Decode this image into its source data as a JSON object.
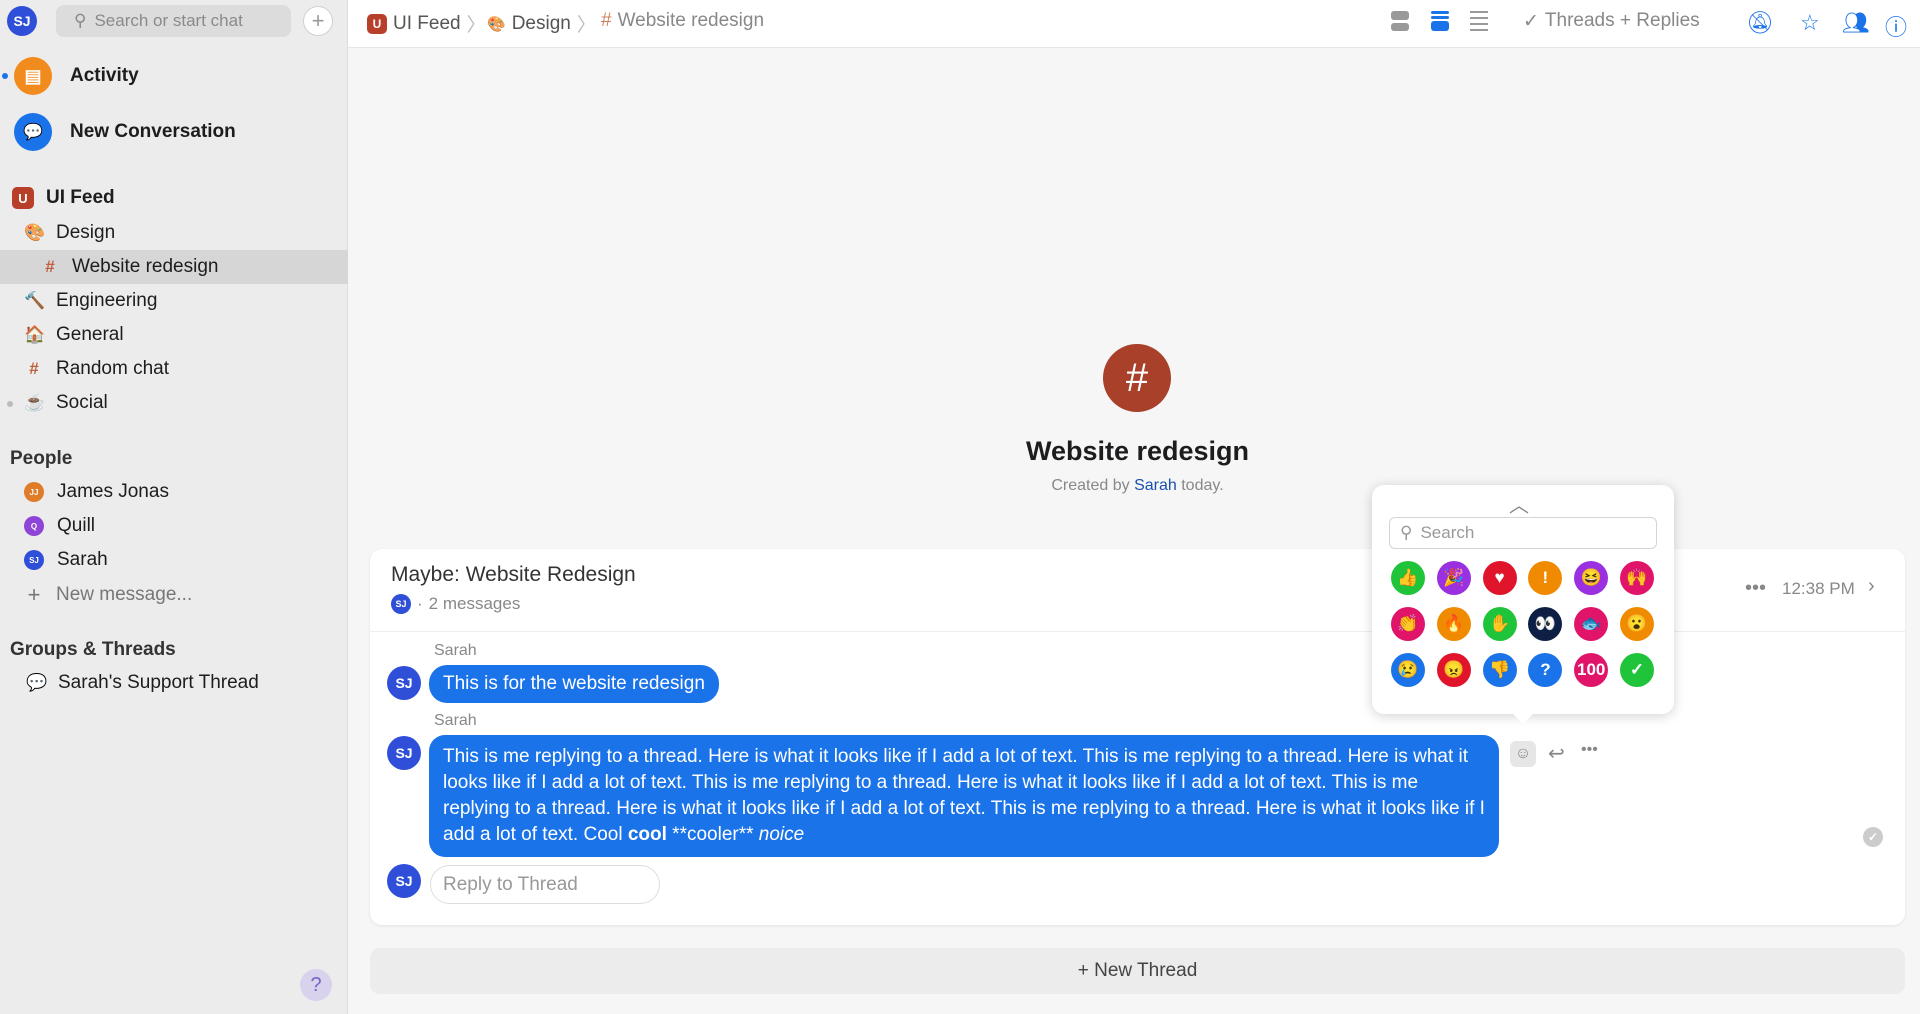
{
  "sidebar": {
    "user_initials": "SJ",
    "search_placeholder": "Search or start chat",
    "activity": "Activity",
    "new_conversation": "New Conversation",
    "workspace": "UI Feed",
    "channels": [
      {
        "label": "Design",
        "icon": "palette-icon",
        "glyph": "🎨",
        "indent": 1
      },
      {
        "label": "Website redesign",
        "icon": "hash-icon",
        "glyph": "#",
        "indent": 2,
        "selected": true
      },
      {
        "label": "Engineering",
        "icon": "hammer-icon",
        "glyph": "🔨",
        "indent": 1
      },
      {
        "label": "General",
        "icon": "home-icon",
        "glyph": "🏠",
        "indent": 1
      },
      {
        "label": "Random chat",
        "icon": "hash-icon",
        "glyph": "#",
        "indent": 1
      },
      {
        "label": "Social",
        "icon": "coffee-icon",
        "glyph": "☕",
        "indent": 1
      }
    ],
    "people_heading": "People",
    "people": [
      {
        "label": "James Jonas",
        "initials": "JJ",
        "color": "#e07b2a"
      },
      {
        "label": "Quill",
        "initials": "Q",
        "color": "#8e44d6"
      },
      {
        "label": "Sarah",
        "initials": "SJ",
        "color": "#2f4fd8"
      }
    ],
    "new_message": "New message...",
    "groups_heading": "Groups & Threads",
    "groups": [
      "Sarah's Support Thread"
    ],
    "help": "?"
  },
  "topbar": {
    "breadcrumb": [
      "UI Feed",
      "Design",
      "Website redesign"
    ],
    "filter_label": "Threads + Replies",
    "accent": "#1a73e8"
  },
  "channel": {
    "glyph": "#",
    "title": "Website redesign",
    "created_prefix": "Created by",
    "created_by": "Sarah",
    "created_suffix": "today."
  },
  "thread": {
    "title": "Maybe: Website Redesign",
    "count": "2 messages",
    "time": "12:38 PM",
    "messages": [
      {
        "author": "Sarah",
        "initials": "SJ",
        "text": "This is for the website redesign"
      },
      {
        "author": "Sarah",
        "initials": "SJ",
        "text": "This is me replying to a thread. Here is what it looks like if I add a lot of text. This is me replying to a thread. Here is what it looks like if I add a lot of text. This is me replying to a thread. Here is what it looks like if I add a lot of text. This is me replying to a thread. Here is what it looks like if I add a lot of text. This is me replying to a thread. Here is what it looks like if I add a lot of text. Cool ",
        "bold": "cool",
        "plain": " **cooler** ",
        "italic": "noice"
      }
    ],
    "reply_placeholder": "Reply to Thread"
  },
  "new_thread": "+ New Thread",
  "emoji_picker": {
    "search_placeholder": "Search",
    "emojis": [
      {
        "name": "thumbs-up",
        "glyph": "👍",
        "color": "#1fc43a"
      },
      {
        "name": "party-popper",
        "glyph": "🎉",
        "color": "#9b30e0"
      },
      {
        "name": "heart",
        "glyph": "♥",
        "color": "#e0152b"
      },
      {
        "name": "exclamation",
        "glyph": "!",
        "color": "#f08a00"
      },
      {
        "name": "laughing",
        "glyph": "😆",
        "color": "#9b30e0"
      },
      {
        "name": "raised-hands",
        "glyph": "🙌",
        "color": "#e0156a"
      },
      {
        "name": "clapping",
        "glyph": "👏",
        "color": "#e0156a"
      },
      {
        "name": "fire",
        "glyph": "🔥",
        "color": "#f08a00"
      },
      {
        "name": "wave",
        "glyph": "✋",
        "color": "#1fc43a"
      },
      {
        "name": "eyes",
        "glyph": "👀",
        "color": "#0d1f45"
      },
      {
        "name": "fish",
        "glyph": "🐟",
        "color": "#e0156a"
      },
      {
        "name": "surprised",
        "glyph": "😮",
        "color": "#f08a00"
      },
      {
        "name": "sad",
        "glyph": "😢",
        "color": "#1a73e8"
      },
      {
        "name": "angry",
        "glyph": "😠",
        "color": "#e0152b"
      },
      {
        "name": "thumbs-down",
        "glyph": "👎",
        "color": "#1a73e8"
      },
      {
        "name": "question",
        "glyph": "?",
        "color": "#1a73e8"
      },
      {
        "name": "hundred",
        "glyph": "100",
        "color": "#e0156a"
      },
      {
        "name": "check",
        "glyph": "✓",
        "color": "#1fc43a"
      }
    ]
  }
}
